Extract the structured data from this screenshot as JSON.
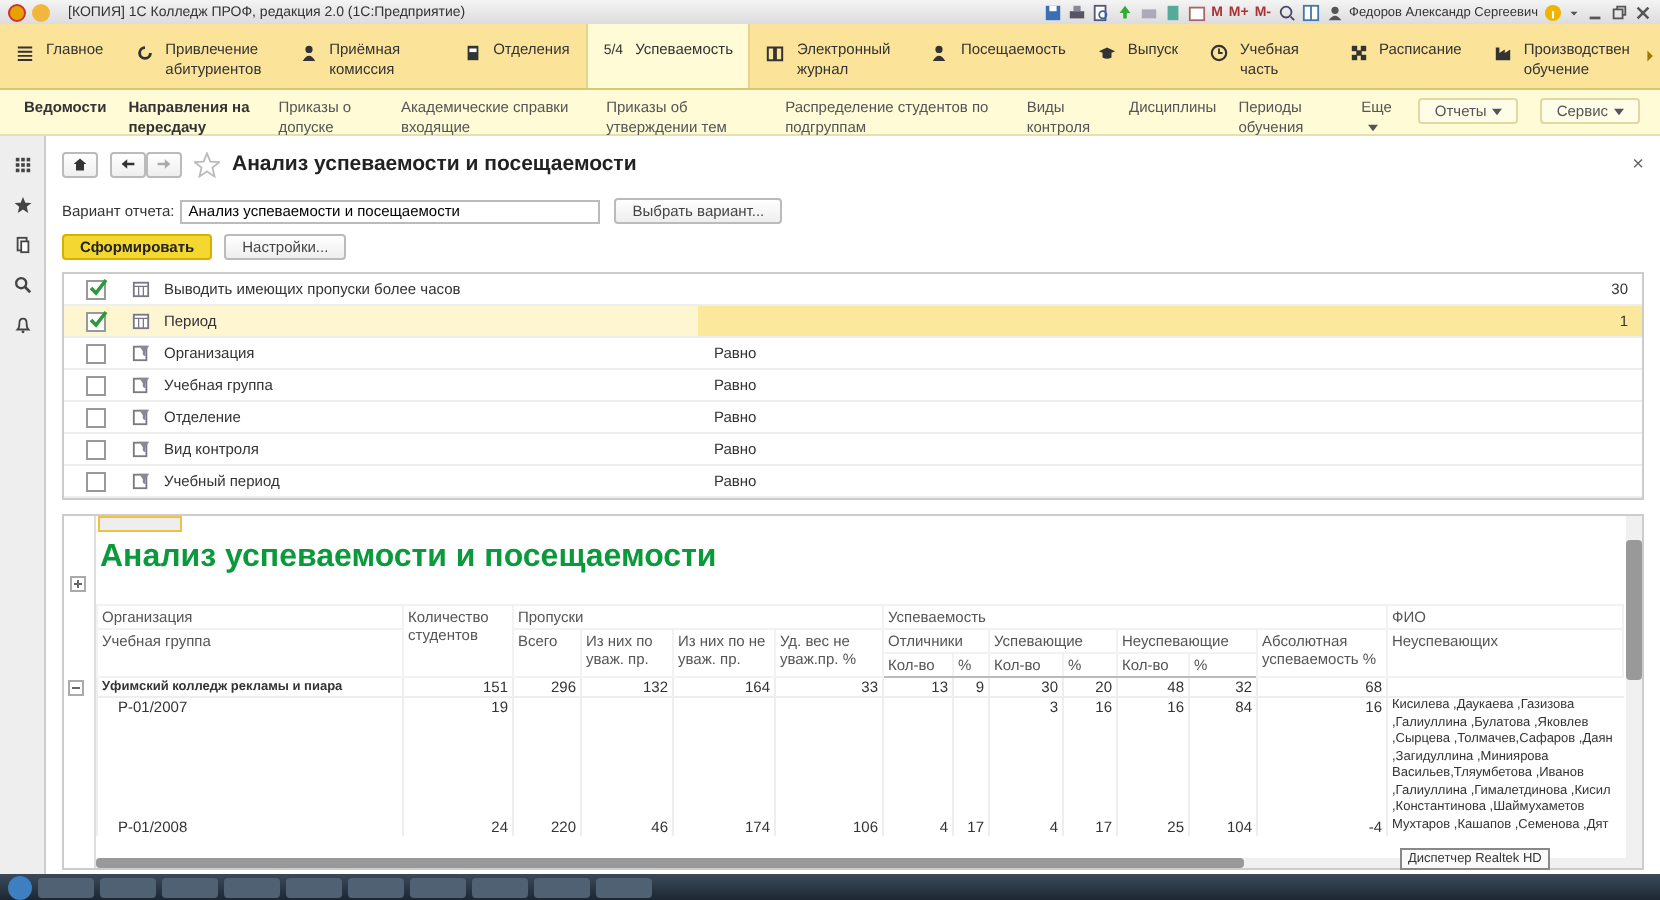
{
  "window": {
    "title": "[КОПИЯ] 1С Колледж ПРОФ, редакция 2.0  (1С:Предприятие)",
    "memory_buttons": [
      "M",
      "M+",
      "M-"
    ],
    "user": "Федоров Александр Сергеевич"
  },
  "sections": [
    {
      "label": "Главное",
      "selected": false
    },
    {
      "label": "Привлечение абитуриентов",
      "selected": false
    },
    {
      "label": "Приёмная комиссия",
      "selected": false
    },
    {
      "label": "Отделения",
      "selected": false
    },
    {
      "label": "Успеваемость",
      "icon_text": "5/4",
      "selected": true
    },
    {
      "label": "Электронный журнал",
      "selected": false
    },
    {
      "label": "Посещаемость",
      "selected": false
    },
    {
      "label": "Выпуск",
      "selected": false
    },
    {
      "label": "Учебная часть",
      "selected": false
    },
    {
      "label": "Расписание",
      "selected": false
    },
    {
      "label": "Производствен обучение",
      "selected": false
    }
  ],
  "subnav": {
    "items": [
      {
        "label": "Ведомости",
        "bold": true
      },
      {
        "label": "Направления на пересдачу",
        "bold": true
      },
      {
        "label": "Приказы о допуске",
        "bold": false
      },
      {
        "label": "Академические справки входящие",
        "bold": false
      },
      {
        "label": "Приказы об утверждении тем",
        "bold": false
      },
      {
        "label": "Распределение студентов по подгруппам",
        "bold": false
      },
      {
        "label": "Виды контроля",
        "bold": false
      },
      {
        "label": "Дисциплины",
        "bold": false
      },
      {
        "label": "Периоды обучения",
        "bold": false
      },
      {
        "label": "Еще",
        "bold": false
      }
    ],
    "buttons": [
      "Отчеты",
      "Сервис"
    ]
  },
  "form": {
    "title": "Анализ успеваемости и посещаемости",
    "close": "×",
    "variant_label": "Вариант отчета:",
    "variant_value": "Анализ успеваемости и посещаемости",
    "choose_button": "Выбрать вариант...",
    "generate_button": "Сформировать",
    "settings_button": "Настройки..."
  },
  "settings": [
    {
      "label": "Выводить имеющих пропуски более часов",
      "checked": true,
      "selected": false,
      "kind": "value",
      "value": "30"
    },
    {
      "label": "Период",
      "checked": true,
      "selected": true,
      "kind": "value",
      "value": "1"
    },
    {
      "label": "Организация",
      "checked": false,
      "selected": false,
      "kind": "filter",
      "condition": "Равно"
    },
    {
      "label": "Учебная группа",
      "checked": false,
      "selected": false,
      "kind": "filter",
      "condition": "Равно"
    },
    {
      "label": "Отделение",
      "checked": false,
      "selected": false,
      "kind": "filter",
      "condition": "Равно"
    },
    {
      "label": "Вид контроля",
      "checked": false,
      "selected": false,
      "kind": "filter",
      "condition": "Равно"
    },
    {
      "label": "Учебный период",
      "checked": false,
      "selected": false,
      "kind": "filter",
      "condition": "Равно"
    }
  ],
  "report": {
    "title": "Анализ успеваемости и посещаемости",
    "headers": {
      "organization": "Организация",
      "students": "Количество студентов",
      "absences": "Пропуски",
      "performance": "Успеваемость",
      "fio": "ФИО",
      "group": "Учебная группа",
      "absence_columns": [
        "Всего",
        "Из них по уваж. пр.",
        "Из них по не уваж. пр.",
        "Уд. вес не уваж.пр. %"
      ],
      "performance_groups": [
        {
          "label": "Отличники",
          "count": "Кол-во",
          "percent": "%"
        },
        {
          "label": "Успевающие",
          "count": "Кол-во",
          "percent": "%"
        },
        {
          "label": "Неуспевающие",
          "count": "Кол-во",
          "percent": "%"
        }
      ],
      "absolute": "Абсолютная успеваемость %",
      "failing": "Неуспевающих"
    },
    "rows": [
      {
        "name": "Уфимский колледж рекламы и пиара",
        "expanded": true,
        "values": {
          "students": "151",
          "total": "296",
          "excused": "132",
          "unexcused": "164",
          "unexcused_share": "33",
          "excellent_count": "13",
          "excellent_pct": "9",
          "passing_count": "30",
          "passing_pct": "20",
          "failing_count": "48",
          "failing_pct": "32",
          "absolute": "68"
        },
        "children": [
          {
            "name": "Р-01/2007",
            "values": {
              "students": "19",
              "passing_count": "3",
              "passing_pct": "16",
              "failing_count": "16",
              "failing_pct": "84",
              "absolute": "16"
            },
            "fio": [
              "Кисилева ,Даукаева ,Газизова",
              ",Галиуллина ,Булатова ,Яковлев",
              ",Сырцева ,Толмачев,Сафаров ,Даян",
              ",Загидуллина ,Миниярова",
              "Васильев,Тляумбетова ,Иванов",
              ",Галиуллина ,Гималетдинова ,Кисил",
              ",Константинова ,Шаймухаметов"
            ]
          },
          {
            "name": "Р-01/2008",
            "values": {
              "students": "24",
              "total": "220",
              "excused": "46",
              "unexcused": "174",
              "unexcused_share": "106",
              "excellent_count": "4",
              "excellent_pct": "17",
              "passing_count": "4",
              "passing_pct": "17",
              "failing_count": "25",
              "failing_pct": "104",
              "absolute": "-4"
            },
            "fio": [
              "Мухтаров ,Кашапов ,Семенова ,Дят"
            ]
          }
        ]
      }
    ]
  },
  "tooltip": "Диспетчер Realtek HD"
}
